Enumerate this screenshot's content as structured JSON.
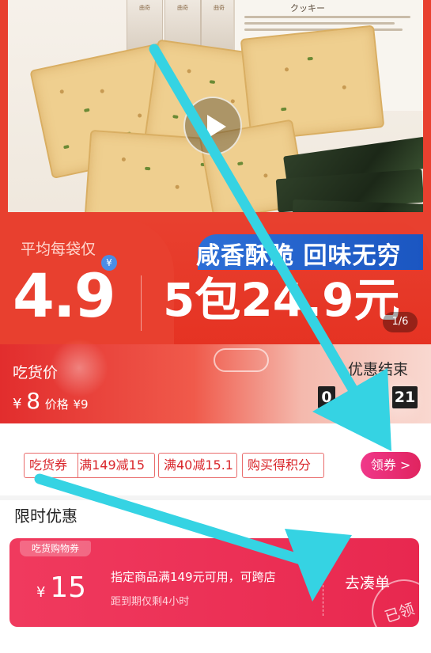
{
  "hero": {
    "bag_text": "曲奇",
    "package_title": "クッキー",
    "slogan": "咸香酥脆 回味无穷",
    "play_icon": "play-icon"
  },
  "price": {
    "avg_label": "平均每袋仅",
    "currency_badge": "¥",
    "avg_price": "4.9",
    "pack_price": "5包24.9元",
    "page_indicator": "1/6"
  },
  "promo": {
    "label": "吃货价",
    "currency": "¥",
    "price": "8",
    "original_prefix": "价格",
    "original_price": "¥9",
    "countdown_title": "优惠结束",
    "countdown_hours": "0",
    "countdown_seconds": "21"
  },
  "coupons": {
    "chip1_a": "吃货券",
    "chip1_b": "满149减15",
    "chip2": "满40减15.1",
    "chip3": "购买得积分",
    "claim_label": "领券 >"
  },
  "limited": {
    "title": "限时优惠",
    "tag": "吃货购物券",
    "currency": "¥",
    "amount": "15",
    "description": "指定商品满149元可用，可跨店",
    "expiry": "距到期仅剩4小时",
    "go_label": "去凑单",
    "claimed_label": "已领"
  },
  "colors": {
    "brand_red": "#e8402f",
    "coupon_pink": "#e8284f",
    "slogan_blue": "#1b56c1",
    "arrow_cyan": "#35d3e3"
  }
}
